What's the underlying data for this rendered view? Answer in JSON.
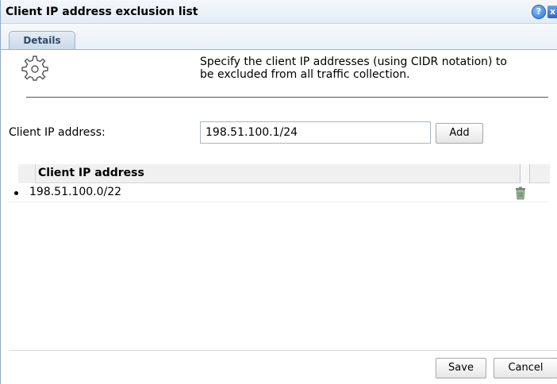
{
  "dialog": {
    "title": "Client IP address exclusion list",
    "help_glyph": "?",
    "close_glyph": "x"
  },
  "tabs": [
    {
      "label": "Details",
      "active": true
    }
  ],
  "description": {
    "line1": "Specify the client IP addresses (using CIDR notation) to",
    "line2": "be excluded from all traffic collection."
  },
  "form": {
    "label": "Client IP address:",
    "value": "198.51.100.1/24",
    "add_label": "Add"
  },
  "table": {
    "column_header": "Client IP address",
    "rows": [
      {
        "ip": "198.51.100.0/22",
        "delete_icon": "trash-icon"
      }
    ]
  },
  "footer": {
    "save_label": "Save",
    "cancel_label": "Cancel"
  },
  "icons": {
    "header_icon": "gear-icon",
    "accent": "#9bb3cc"
  }
}
